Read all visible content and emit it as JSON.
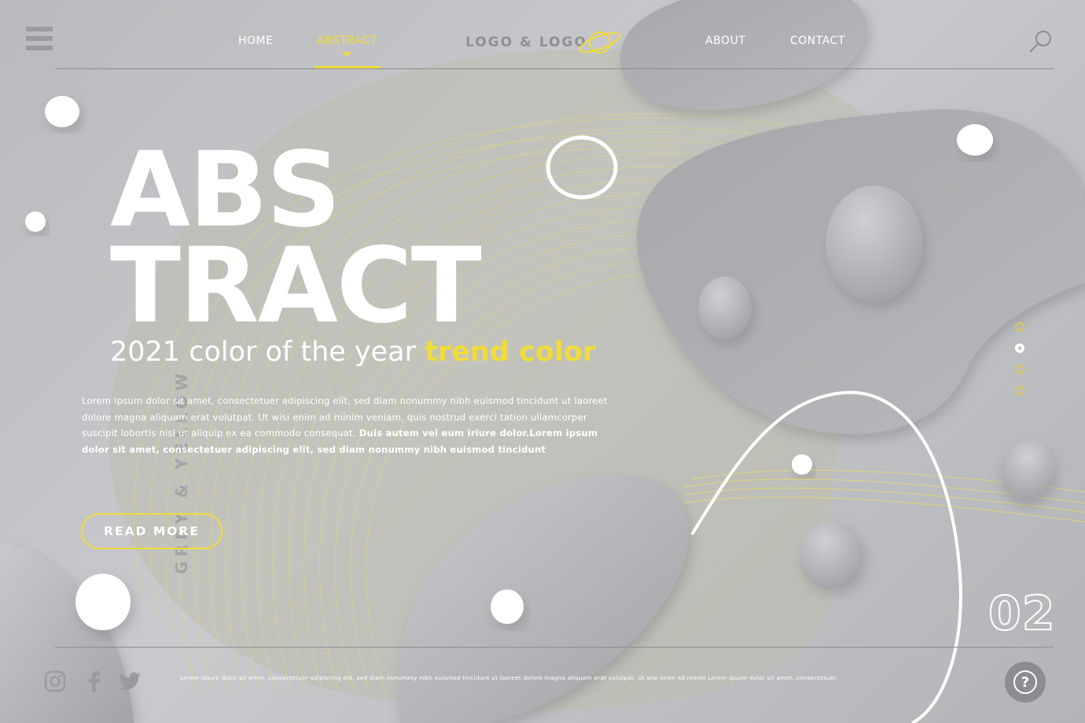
{
  "nav": {
    "items": [
      {
        "label": "HOME",
        "active": false
      },
      {
        "label": "ABSTRACT",
        "active": true
      },
      {
        "label": "ABOUT",
        "active": false
      },
      {
        "label": "CONTACT",
        "active": false
      }
    ],
    "logo": "LOGO & LOGO",
    "menu_icon": "hamburger-menu-icon",
    "search_icon": "search-icon",
    "logo_icon": "planet-icon"
  },
  "hero": {
    "vertical_tag": "GREY & YELLOW",
    "title_line1": "ABS",
    "title_line2": "TRACT",
    "subtitle_prefix": "2021 color of the year ",
    "subtitle_highlight": "trend color",
    "body_regular": "Lorem ipsum dolor sit amet, consectetuer adipiscing elit, sed diam nonummy nibh euismod tincidunt ut laoreet dolore magna aliquam erat volutpat. Ut wisi enim ad minim veniam, quis nostrud exerci tation ullamcorper suscipit lobortis nisl ut aliquip ex ea commodo consequat. ",
    "body_bold": "Duis autem vel eum iriure dolor.Lorem ipsum dolor sit amet, consectetuer adipiscing elit, sed diam nonummy nibh euismod tincidunt",
    "cta": "READ MORE"
  },
  "pagination": {
    "active_dot": 2,
    "dot_count": 4,
    "page_number": "02"
  },
  "footer": {
    "text": "Lorem ipsum dolor sit amet, consectetuer adipiscing elit, sed diam nonummy nibh euismod tincidunt ut laoreet dolore magna aliquam erat volutpat. Ut wisi enim ad minim Lorem ipsum dolor sit amet, consectetuer.",
    "social_icons": [
      "instagram-icon",
      "facebook-icon",
      "twitter-icon"
    ],
    "help_label": "?"
  },
  "colors": {
    "accent_yellow": "#f1dc3b",
    "background_grey": "#c1c2c5",
    "blob_grey": "#a9aaad",
    "text_white": "#ffffff"
  }
}
